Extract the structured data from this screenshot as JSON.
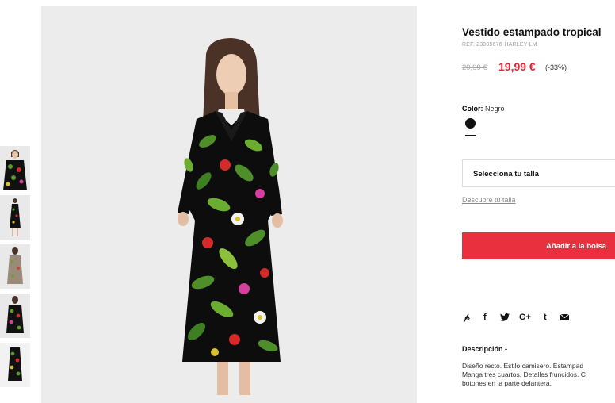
{
  "product": {
    "title": "Vestido estampado tropical",
    "ref": "REF. 23005676-HARLEY-LM",
    "old_price": "29,99 €",
    "new_price": "19,99 €",
    "discount": "(-33%)"
  },
  "color": {
    "label": "Color:",
    "value": "Negro",
    "swatch_color": "#111111"
  },
  "size": {
    "select_label": "Selecciona tu talla",
    "guide_link": "Descubre tu talla"
  },
  "cta": {
    "add_to_bag": "Añadir a la bolsa",
    "color": "#e8303f"
  },
  "social": {
    "icons": [
      "pinterest-icon",
      "facebook-icon",
      "twitter-icon",
      "google-plus-icon",
      "tumblr-icon",
      "email-icon"
    ]
  },
  "description": {
    "title": "Descripción -",
    "lines": [
      "Diseño recto. Estilo camisero. Estampad",
      "Manga tres cuartos. Detalles fruncidos. C",
      "botones en la parte delantera."
    ]
  },
  "colors": {
    "price_red": "#e02937",
    "dress_base": "#0d0d0d",
    "leaf_green": "#4f8f2a",
    "flower_red": "#d42a2a",
    "flower_pink": "#d63fa0"
  }
}
